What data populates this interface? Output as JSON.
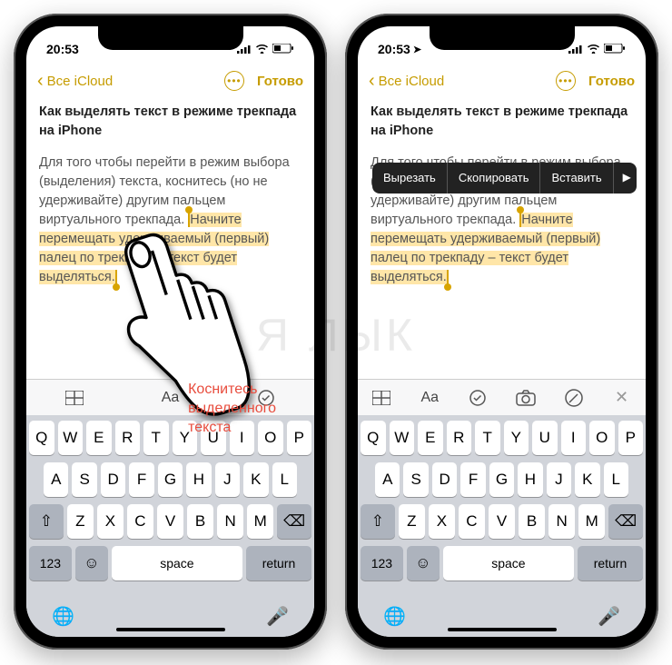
{
  "watermark": "Я ЛЫК",
  "instruction_line1": "Коснитесь",
  "instruction_line2": "выделенного",
  "instruction_line3": "текста",
  "status": {
    "time": "20:53",
    "location_arrow": "➤"
  },
  "nav": {
    "back": "Все iCloud",
    "done": "Готово",
    "more": "•••"
  },
  "note": {
    "title": "Как выделять текст в режиме трекпада на iPhone",
    "para_before": "Для того чтобы перейти в режим выбора (выделения) текста, коснитесь (но не удерживайте) другим пальцем виртуального трекпада. ",
    "para_hl": "Начните перемещать удерживаемый (первый) палец по трекпаду – текст будет выделяться."
  },
  "context_menu": {
    "cut": "Вырезать",
    "copy": "Скопировать",
    "paste": "Вставить",
    "more": "▶"
  },
  "toolbar": {
    "table": "table-icon",
    "aa": "Aa",
    "check": "✓",
    "camera": "camera-icon",
    "pen": "pen-icon",
    "close": "✕"
  },
  "keyboard": {
    "row1": [
      "Q",
      "W",
      "E",
      "R",
      "T",
      "Y",
      "U",
      "I",
      "O",
      "P"
    ],
    "row2": [
      "A",
      "S",
      "D",
      "F",
      "G",
      "H",
      "J",
      "K",
      "L"
    ],
    "row3": [
      "Z",
      "X",
      "C",
      "V",
      "B",
      "N",
      "M"
    ],
    "shift": "⇧",
    "delete": "⌫",
    "numbers": "123",
    "emoji": "☺",
    "space": "space",
    "return": "return",
    "globe": "🌐",
    "mic": "🎤"
  }
}
